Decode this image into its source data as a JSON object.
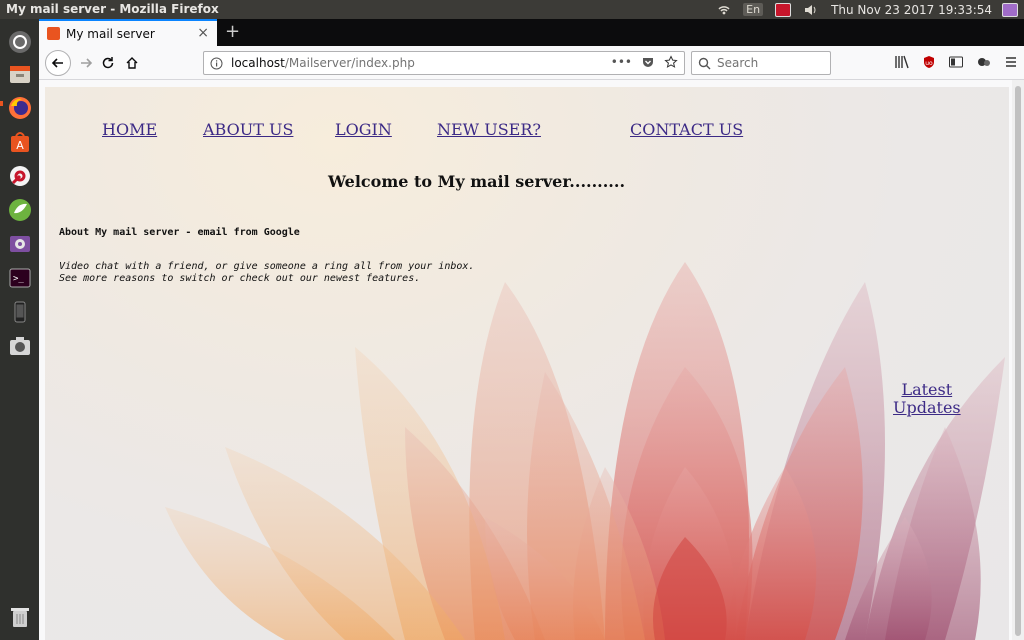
{
  "desktop": {
    "window_title": "My mail server - Mozilla Firefox",
    "tray": {
      "keyboard_layout": "En",
      "clock": "Thu Nov 23 2017 19:33:54"
    }
  },
  "browser": {
    "tab": {
      "title": "My mail server"
    },
    "url": {
      "host": "localhost",
      "path": "/Mailserver/index.php"
    },
    "search": {
      "placeholder": "Search"
    },
    "colors": {
      "accent": "#0a84ff"
    }
  },
  "page": {
    "nav": {
      "home": "HOME",
      "about": "ABOUT US",
      "login": "LOGIN",
      "new_user": "NEW USER?",
      "contact": "CONTACT US"
    },
    "welcome": "Welcome to My mail server..........",
    "about_title": "About My mail server - email from Google",
    "about_line1": "Video chat with a friend, or give someone a ring all from your inbox.",
    "about_line2": "See more reasons to switch or check out our newest features.",
    "latest_line1": "Latest",
    "latest_line2": "Updates",
    "colors": {
      "link": "#3c2a86"
    }
  }
}
